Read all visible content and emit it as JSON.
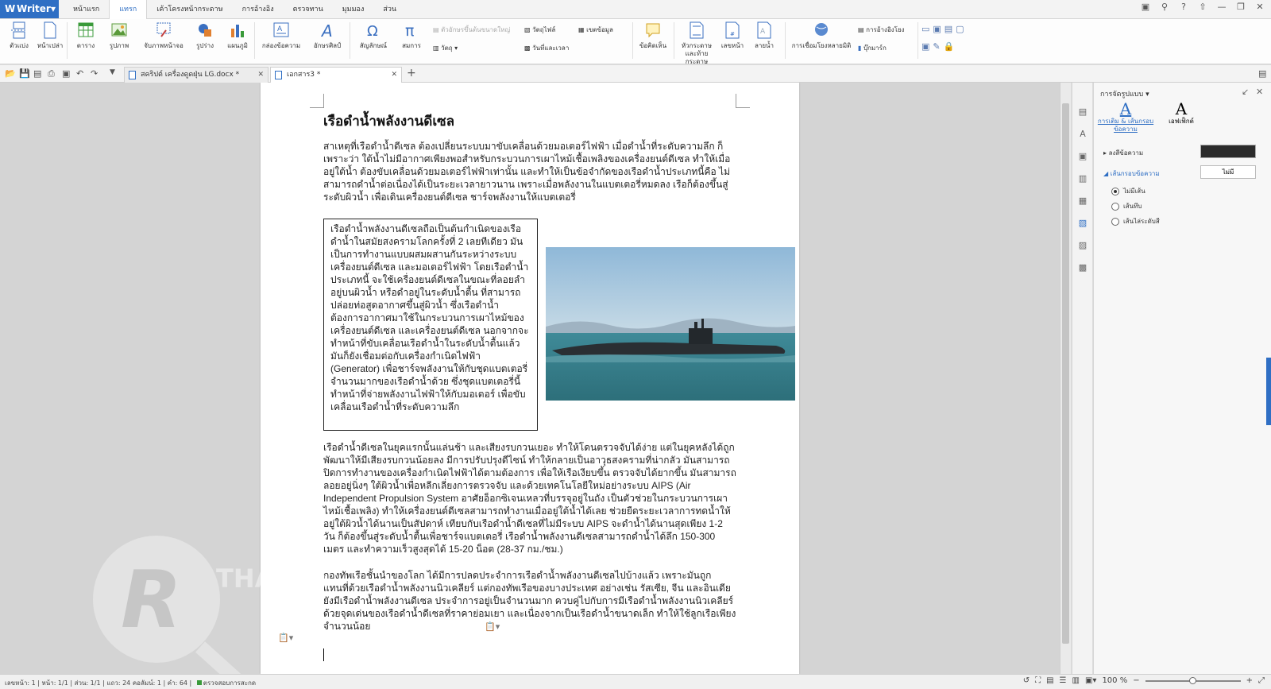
{
  "app": {
    "name": "Writer",
    "accent": "#2f6fc4"
  },
  "menu": {
    "tabs": [
      "หน้าแรก",
      "แทรก",
      "เค้าโครงหน้ากระดาษ",
      "การอ้างอิง",
      "ตรวจทาน",
      "มุมมอง",
      "ส่วน"
    ],
    "active": "แทรก"
  },
  "ribbon": {
    "cover_page": "ตัวแบ่ง",
    "blank_page": "หน้าเปล่า",
    "table": "ตาราง",
    "picture": "รูปภาพ",
    "screenshot": "จับภาพหน้าจอ",
    "shapes": "รูปร่าง",
    "chart": "แผนภูมิ",
    "textbox": "กล่องข้อความ",
    "wordart": "อักษรศิลป์",
    "symbol": "สัญลักษณ์",
    "equation": "สมการ",
    "dropcap": "ตัวอักษรขึ้นต้นขนาดใหญ่",
    "object": "วัตถุ",
    "attach_file": "วัตถุไฟล์",
    "insert_field": "เขตข้อมูล",
    "datetime": "วันที่และเวลา",
    "comment": "ข้อคิดเห็น",
    "header_footer": "หัวกระดาษและท้ายกระดาษ",
    "page_number": "เลขหน้า",
    "watermark": "ลายน้ำ",
    "hyperlink": "การเชื่อมโยงหลายมิติ",
    "crossref": "การอ้างอิงโยง",
    "bookmark": "บุ๊กมาร์ก"
  },
  "tabs": {
    "doc1": "สคริปต์ เครื่องดูดฝุ่น LG.docx *",
    "doc2": "เอกสาร3 *"
  },
  "document": {
    "title": "เรือดำน้ำพลังงานดีเซล",
    "para1": "สาเหตุที่เรือดำน้ำดีเซล ต้องเปลี่ยนระบบมาขับเคลื่อนด้วยมอเตอร์ไฟฟ้า เมื่อดำน้ำที่ระดับความลึก ก็เพราะว่า ใต้น้ำไม่มีอากาศเพียงพอสำหรับกระบวนการเผาไหม้เชื้อเพลิงของเครื่องยนต์ดีเซล ทำให้เมื่ออยู่ใต้น้ำ ต้องขับเคลื่อนด้วยมอเตอร์ไฟฟ้าเท่านั้น และทำให้เป็นข้อจำกัดของเรือดำน้ำประเภทนี้คือ ไม่สามารถดำน้ำต่อเนื่องได้เป็นระยะเวลายาวนาน เพราะเมื่อพลังงานในแบตเตอรี่หมดลง เรือก็ต้องขึ้นสู่ระดับผิวน้ำ เพื่อเดินเครื่องยนต์ดีเซล ชาร์จพลังงานให้แบตเตอรี่",
    "textbox": "เรือดำน้ำพลังงานดีเซลถือเป็นต้นกำเนิดของเรือดำน้ำในสมัยสงครามโลกครั้งที่ 2 เลยทีเดียว มันเป็นการทำงานแบบผสมผสานกันระหว่างระบบเครื่องยนต์ดีเซล และมอเตอร์ไฟฟ้า โดยเรือดำน้ำประเภทนี้ จะใช้เครื่องยนต์ดีเซลในขณะที่ลอยลำอยู่บนผิวน้ำ หรือดำอยู่ในระดับน้ำตื้น ที่สามารถปล่อยท่อสูดอากาศขึ้นสู่ผิวน้ำ ซึ่งเรือดำน้ำ ต้องการอากาศมาใช้ในกระบวนการเผาไหม้ของเครื่องยนต์ดีเซล และเครื่องยนต์ดีเซล นอกจากจะทำหน้าที่ขับเคลื่อนเรือดำน้ำในระดับน้ำตื้นแล้ว มันก็ยังเชื่อมต่อกับเครื่องกำเนิดไฟฟ้า (Generator) เพื่อชาร์จพลังงานให้กับชุดแบตเตอรี่จำนวนมากของเรือดำน้ำด้วย ซึ่งชุดแบตเตอรี่นี้ทำหน้าที่จ่ายพลังงานไฟฟ้าให้กับมอเตอร์ เพื่อขับเคลื่อนเรือดำน้ำที่ระดับความลึก",
    "para2": "เรือดำน้ำดีเซลในยุคแรกนั้นแล่นช้า และเสียงรบกวนเยอะ ทำให้โดนตรวจจับได้ง่าย แต่ในยุคหลังได้ถูกพัฒนาให้มีเสียงรบกวนน้อยลง มีการปรับปรุงดีไซน์ ทำให้กลายเป็นอาวุธสงครามที่น่ากลัว มันสามารถปิดการทำงานของเครื่องกำเนิดไฟฟ้าได้ตามต้องการ เพื่อให้เรือเงียบขึ้น ตรวจจับได้ยากขึ้น มันสามารถลอยอยู่นิ่งๆ ใต้ผิวน้ำเพื่อหลีกเลี่ยงการตรวจจับ และด้วยเทคโนโลยีใหม่อย่างระบบ AIPS (Air Independent Propulsion System อาศัยอ็อกซิเจนเหลวที่บรรจุอยู่ในถัง เป็นตัวช่วยในกระบวนการเผาไหม้เชื้อเพลิง) ทำให้เครื่องยนต์ดีเซลสามารถทำงานเมื่ออยู่ใต้น้ำได้เลย ช่วยยืดระยะเวลาการทดน้ำให้อยู่ใต้ผิวน้ำได้นานเป็นสัปดาห์ เทียบกับเรือดำน้ำดีเซลที่ไม่มีระบบ AIPS จะดำน้ำได้นานสุดเพียง 1-2 วัน ก็ต้องขึ้นสู่ระดับน้ำตื้นเพื่อชาร์จแบตเตอรี่ เรือดำน้ำพลังงานดีเซลสามารถดำน้ำได้ลึก 150-300 เมตร และทำความเร็วสูงสุดได้ 15-20 น็อต (28-37 กม./ชม.)",
    "para3": "กองทัพเรือชั้นนำของโลก ได้มีการปลดประจำการเรือดำน้ำพลังงานดีเซลไปบ้างแล้ว เพราะมันถูกแทนที่ด้วยเรือดำน้ำพลังงานนิวเคลียร์ แต่กองทัพเรือของบางประเทศ อย่างเช่น รัสเซีย, จีน และอินเดีย ยังมีเรือดำน้ำพลังงานดีเซล ประจำการอยู่เป็นจำนวนมาก ควบคู่ไปกับการมีเรือดำน้ำพลังงานนิวเคลียร์ ด้วยจุดเด่นของเรือดำน้ำดีเซลที่ราคาย่อมเยา และเนื่องจากเป็นเรือดำน้ำขนาดเล็ก ทำให้ใช้ลูกเรือเพียงจำนวนน้อย",
    "watermark_text": "THAI REVIEW"
  },
  "panel": {
    "title": "การจัดรูปแบบ",
    "tab1": "การเติม & เส้นกรอบข้อความ",
    "tab2": "เอฟเฟ็กต์",
    "fill_label": "ลงสีข้อความ",
    "outline_label": "เส้นกรอบข้อความ",
    "outline_value": "ไม่มี",
    "options": [
      "ไม่มีเส้น",
      "เส้นทึบ",
      "เส้นไล่ระดับสี"
    ],
    "selected": 0
  },
  "status": {
    "page_num": "เลขหน้า: 1",
    "page": "หน้า: 1/1",
    "section": "ส่วน: 1/1",
    "line": "แถว: 24",
    "column": "คอลัมน์: 1",
    "words": "คำ: 64",
    "spell": "ตรวจสอบการสะกด",
    "zoom": "100 %"
  }
}
